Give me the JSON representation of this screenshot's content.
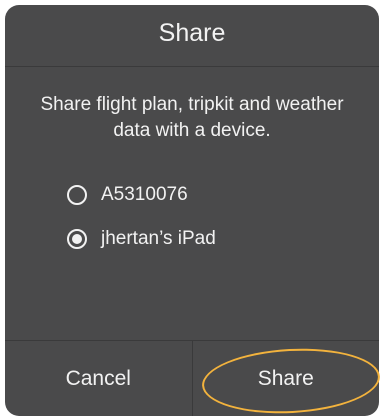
{
  "dialog": {
    "title": "Share",
    "message": "Share flight plan, tripkit and weather data with a device.",
    "devices": [
      {
        "label": "A5310076",
        "selected": false
      },
      {
        "label": "jhertan’s iPad",
        "selected": true
      }
    ],
    "cancel_label": "Cancel",
    "share_label": "Share"
  },
  "colors": {
    "dialog_background": "#4a4a4b",
    "text": "#f2f2f2",
    "highlight_annotation": "#f3b33d"
  }
}
